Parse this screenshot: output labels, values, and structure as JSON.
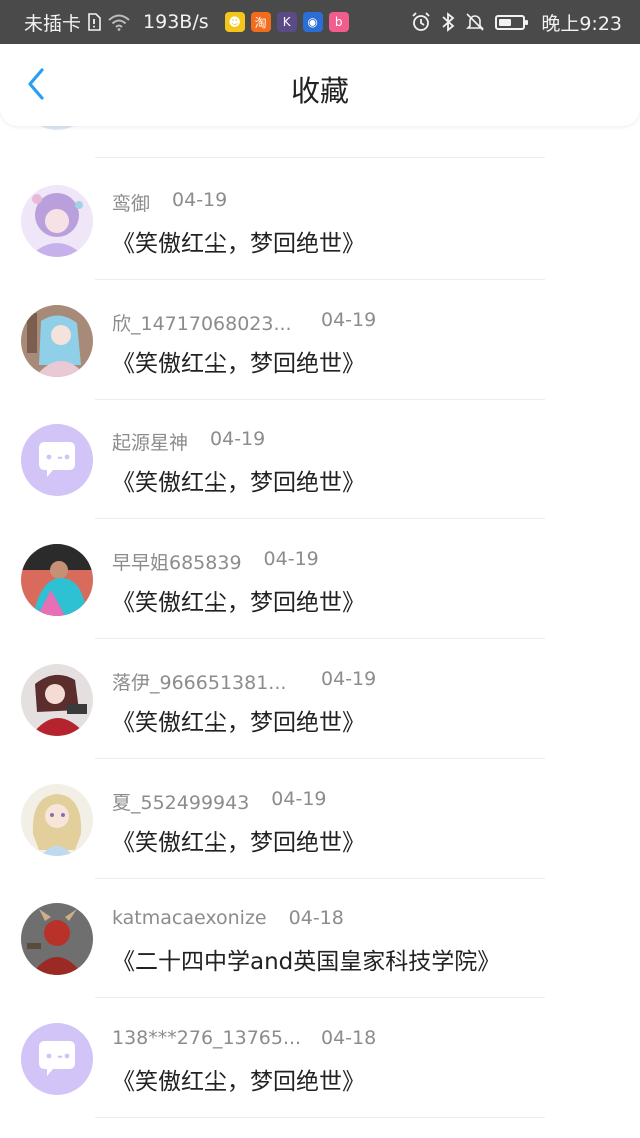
{
  "status_bar": {
    "carrier": "未插卡",
    "net_speed": "193B/s",
    "time": "晚上9:23",
    "battery_level": 0.55,
    "app_icons": [
      {
        "name": "qq-browser-icon",
        "glyph": "☻",
        "color": "#f4c51b"
      },
      {
        "name": "taobao-icon",
        "glyph": "淘",
        "color": "#f36c1d"
      },
      {
        "name": "k-app-icon",
        "glyph": "K",
        "color": "#5a4b86"
      },
      {
        "name": "bulb-app-icon",
        "glyph": "◉",
        "color": "#2b6fd6"
      },
      {
        "name": "bilibili-icon",
        "glyph": "b",
        "color": "#f25d8e"
      }
    ]
  },
  "header": {
    "title": "收藏",
    "back_icon": "chevron-left-icon",
    "accent": "#2a9df4"
  },
  "items": [
    {
      "user": "鸾御",
      "date": "04-19",
      "post": "《笑傲红尘，梦回绝世》",
      "avatar": "anime-girl-purple"
    },
    {
      "user": "欣_14717068023...",
      "date": "04-19",
      "post": "《笑傲红尘，梦回绝世》",
      "avatar": "anime-girl-blue-hair"
    },
    {
      "user": "起源星神",
      "date": "04-19",
      "post": "《笑傲红尘，梦回绝世》",
      "avatar": "default-chat-bubble"
    },
    {
      "user": "早早姐685839",
      "date": "04-19",
      "post": "《笑傲红尘，梦回绝世》",
      "avatar": "photo-person-blue"
    },
    {
      "user": "落伊_966651381...",
      "date": "04-19",
      "post": "《笑傲红尘，梦回绝世》",
      "avatar": "anime-girl-red"
    },
    {
      "user": "夏_552499943",
      "date": "04-19",
      "post": "《笑傲红尘，梦回绝世》",
      "avatar": "anime-girl-blonde"
    },
    {
      "user": "katmacaexonize",
      "date": "04-18",
      "post": "《二十四中学and英国皇家科技学院》",
      "avatar": "red-demon"
    },
    {
      "user": "138***276_13765...",
      "date": "04-18",
      "post": "《笑傲红尘，梦回绝世》",
      "avatar": "default-chat-bubble"
    }
  ]
}
